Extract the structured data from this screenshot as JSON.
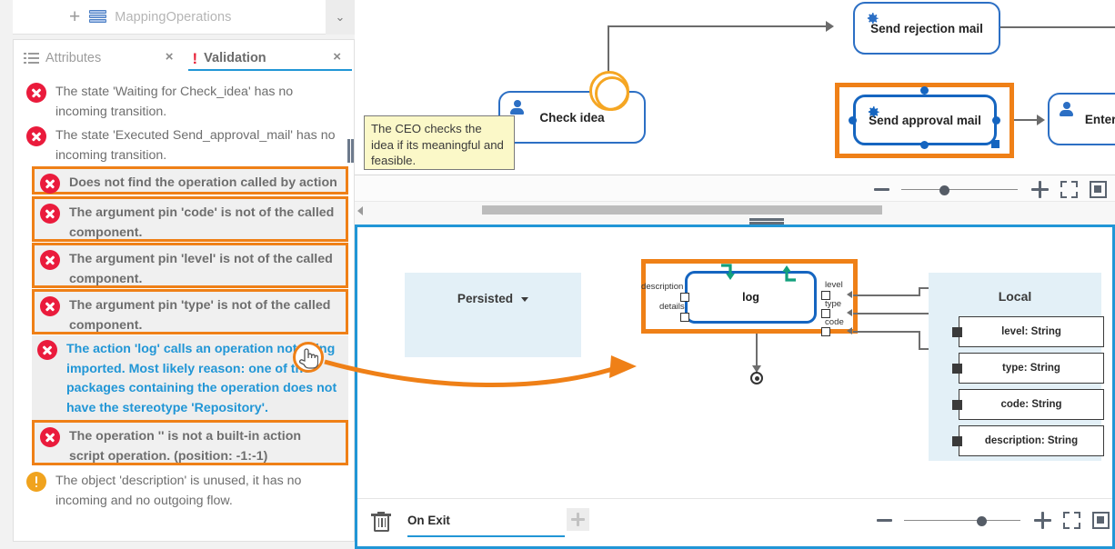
{
  "left_panel": {
    "mapping_bar": {
      "plus_label": "+",
      "title": "MappingOperations",
      "chevron": "⌄"
    },
    "tabs": [
      {
        "label": "Attributes",
        "icon": "list-icon",
        "close": "×",
        "active": false
      },
      {
        "label": "Validation",
        "icon": "exclamation-icon",
        "close": "×",
        "active": true
      }
    ],
    "validation_items": [
      {
        "severity": "error",
        "text": "The state 'Waiting for Check_idea' has no incoming transition.",
        "style": "plain"
      },
      {
        "severity": "error",
        "text": "The state 'Executed Send_approval_mail' has no incoming transition.",
        "style": "plain"
      },
      {
        "severity": "error",
        "text": "Does not find the operation called by action 'log'.",
        "style": "highlight"
      },
      {
        "severity": "error",
        "text": "The argument pin 'code' is not of the called component.",
        "style": "highlight"
      },
      {
        "severity": "error",
        "text": "The argument pin 'level' is not of the called component.",
        "style": "highlight"
      },
      {
        "severity": "error",
        "text": "The argument pin 'type' is not of the called component.",
        "style": "highlight"
      },
      {
        "severity": "error",
        "text": "The action 'log' calls an operation not being imported. Most likely reason: one of the packages containing the operation does not have the stereotype 'Repository'.",
        "style": "selected"
      },
      {
        "severity": "error",
        "text": "The operation '' is not a built-in action script operation. (position: -1:-1)",
        "style": "highlight"
      },
      {
        "severity": "warning",
        "text": "The object 'description' is unused, it has no incoming and no outgoing flow.",
        "style": "plain"
      }
    ]
  },
  "top_diagram": {
    "nodes": [
      {
        "id": "check-idea",
        "label": "Check idea",
        "icon": "person-icon"
      },
      {
        "id": "send-rejection-mail",
        "label": "Send rejection mail",
        "icon": "gear-icon"
      },
      {
        "id": "send-approval-mail",
        "label": "Send approval mail",
        "icon": "gear-icon",
        "selected": true
      },
      {
        "id": "enter-for",
        "label": "Enter for",
        "icon": "person-icon"
      }
    ],
    "tooltip": "The CEO checks the idea if its meaningful and feasible.",
    "toolbar": {
      "zoom_out": "minus-icon",
      "zoom_in": "plus-icon",
      "fit": "fit-to-screen-icon",
      "window": "fit-to-window-icon",
      "slider_value": 28
    }
  },
  "bottom_panel": {
    "persisted": {
      "label": "Persisted",
      "caret": "dropdown-caret-icon"
    },
    "local": {
      "title": "Local",
      "items": [
        {
          "label": "level: String"
        },
        {
          "label": "type: String"
        },
        {
          "label": "code: String"
        },
        {
          "label": "description: String"
        }
      ]
    },
    "activity": {
      "label": "log",
      "input_pins": [
        "description",
        "details"
      ],
      "output_pins": [
        "level",
        "type",
        "code"
      ],
      "selected": true
    },
    "toolbar": {
      "delete": "trash-icon",
      "tab_label": "On Exit",
      "add_tab": "plus-icon",
      "zoom_out": "minus-icon",
      "zoom_in": "plus-icon",
      "fit": "fit-to-screen-icon",
      "window": "fit-to-window-icon",
      "slider_value": 55
    }
  },
  "colors": {
    "accent_blue": "#2196d6",
    "highlight_orange": "#ef8017",
    "error_red": "#ea1b3c",
    "warning_amber": "#f0a31e",
    "node_blue": "#1565c0",
    "panel_blue": "#e3f0f7",
    "green": "#12a07d"
  }
}
